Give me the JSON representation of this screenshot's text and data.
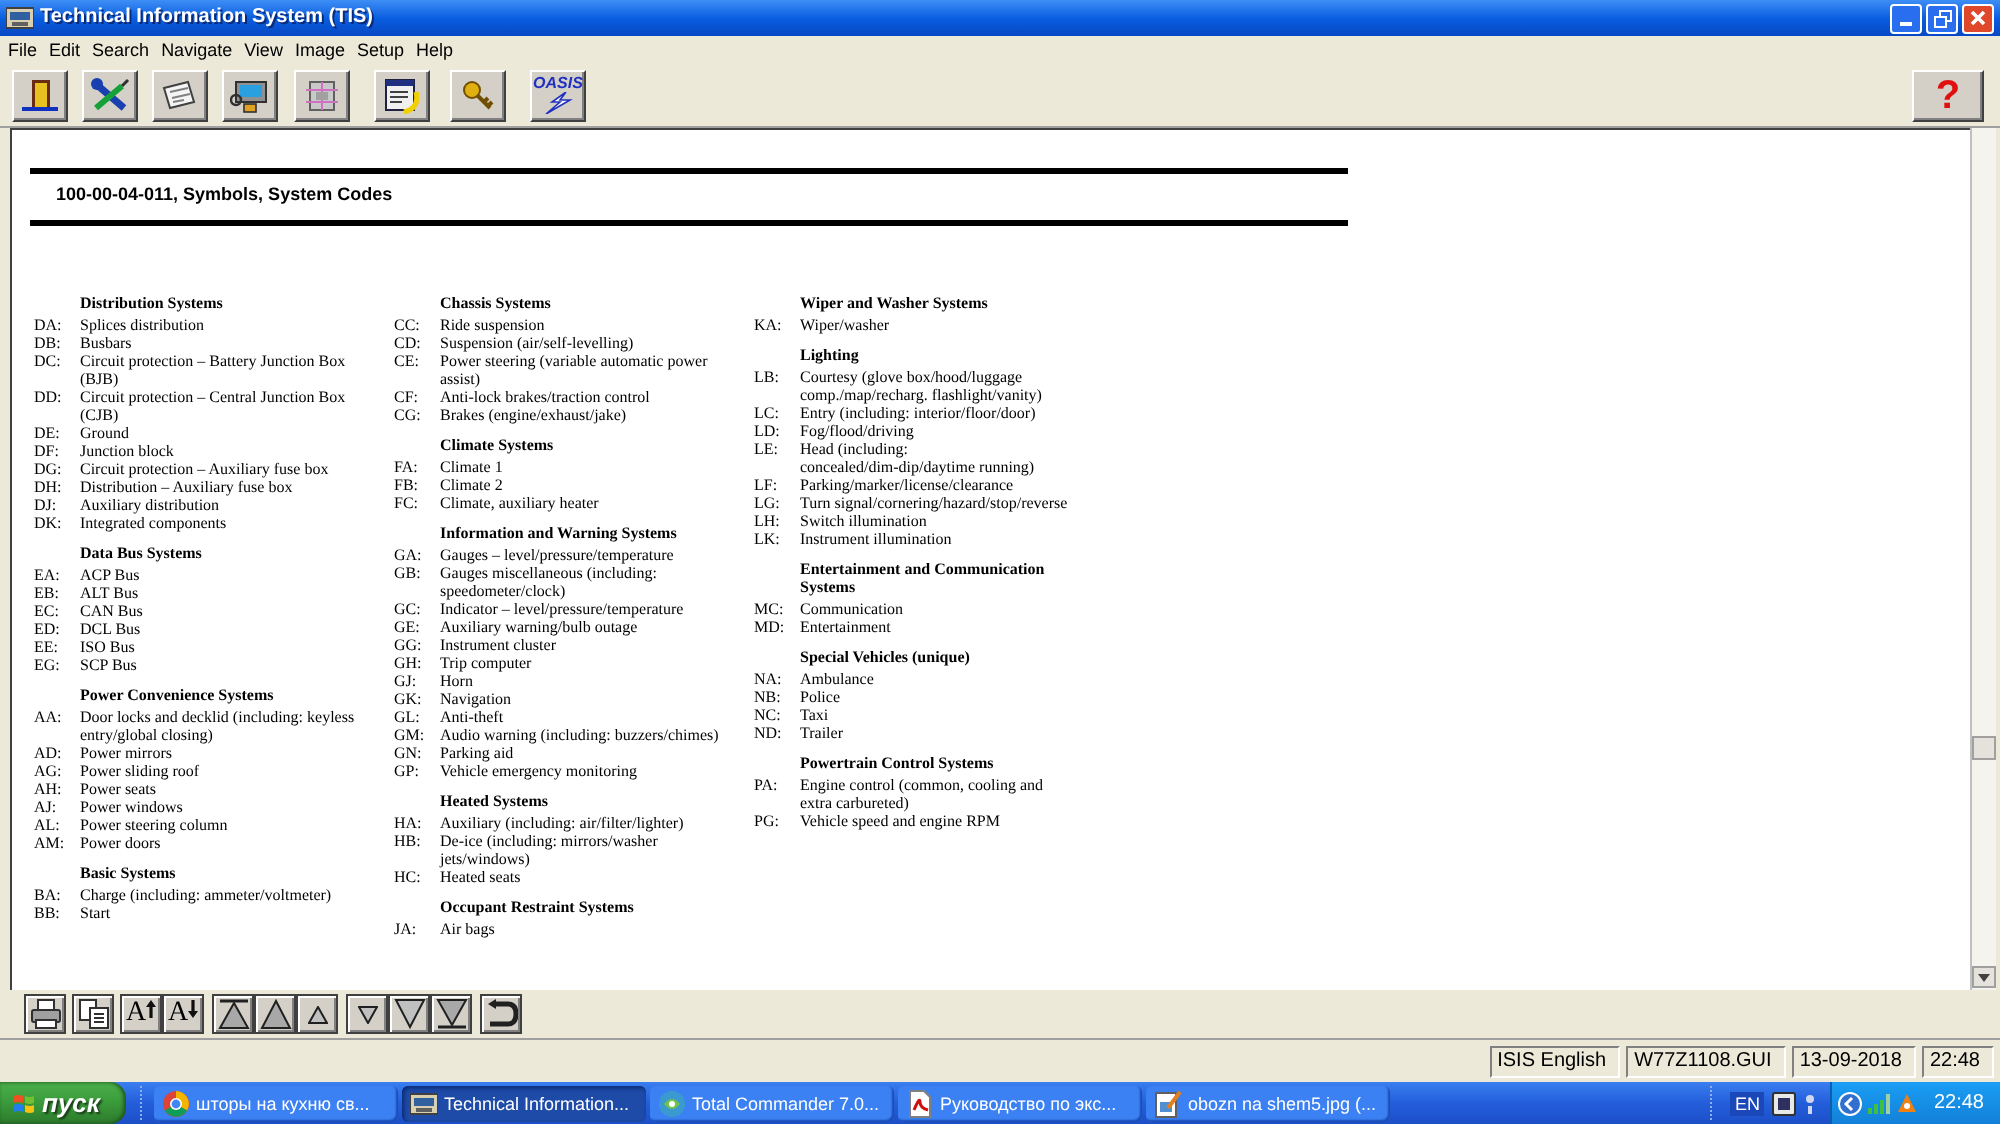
{
  "window": {
    "title": "Technical Information System (TIS)"
  },
  "menu": [
    "File",
    "Edit",
    "Search",
    "Navigate",
    "View",
    "Image",
    "Setup",
    "Help"
  ],
  "toolbar": {
    "logo_label": "OASIS",
    "help_label": "?"
  },
  "document": {
    "title": "100-00-04-011, Symbols, System Codes",
    "columns": [
      {
        "sections": [
          {
            "heading": "Distribution Systems",
            "entries": [
              {
                "code": "DA:",
                "text": "Splices distribution"
              },
              {
                "code": "DB:",
                "text": "Busbars"
              },
              {
                "code": "DC:",
                "text": "Circuit protection – Battery Junction Box\n(BJB)"
              },
              {
                "code": "DD:",
                "text": "Circuit protection – Central Junction Box\n(CJB)"
              },
              {
                "code": "DE:",
                "text": "Ground"
              },
              {
                "code": "DF:",
                "text": "Junction block"
              },
              {
                "code": "DG:",
                "text": "Circuit protection – Auxiliary fuse box"
              },
              {
                "code": "DH:",
                "text": "Distribution – Auxiliary fuse box"
              },
              {
                "code": "DJ:",
                "text": "Auxiliary distribution"
              },
              {
                "code": "DK:",
                "text": "Integrated components"
              }
            ]
          },
          {
            "heading": "Data Bus Systems",
            "entries": [
              {
                "code": "EA:",
                "text": "ACP Bus"
              },
              {
                "code": "EB:",
                "text": "ALT Bus"
              },
              {
                "code": "EC:",
                "text": "CAN Bus"
              },
              {
                "code": "ED:",
                "text": "DCL Bus"
              },
              {
                "code": "EE:",
                "text": "ISO Bus"
              },
              {
                "code": "EG:",
                "text": "SCP Bus"
              }
            ]
          },
          {
            "heading": "Power Convenience Systems",
            "entries": [
              {
                "code": "AA:",
                "text": "Door locks and decklid (including: keyless\nentry/global closing)"
              },
              {
                "code": "AD:",
                "text": "Power mirrors"
              },
              {
                "code": "AG:",
                "text": "Power sliding roof"
              },
              {
                "code": "AH:",
                "text": "Power seats"
              },
              {
                "code": "AJ:",
                "text": "Power windows"
              },
              {
                "code": "AL:",
                "text": "Power steering column"
              },
              {
                "code": "AM:",
                "text": "Power doors"
              }
            ]
          },
          {
            "heading": "Basic Systems",
            "entries": [
              {
                "code": "BA:",
                "text": "Charge (including: ammeter/voltmeter)"
              },
              {
                "code": "BB:",
                "text": "Start"
              }
            ]
          }
        ]
      },
      {
        "sections": [
          {
            "heading": "Chassis Systems",
            "entries": [
              {
                "code": "CC:",
                "text": "Ride suspension"
              },
              {
                "code": "CD:",
                "text": "Suspension (air/self-levelling)"
              },
              {
                "code": "CE:",
                "text": "Power steering (variable automatic power\nassist)"
              },
              {
                "code": "CF:",
                "text": "Anti-lock brakes/traction control"
              },
              {
                "code": "CG:",
                "text": "Brakes (engine/exhaust/jake)"
              }
            ]
          },
          {
            "heading": "Climate Systems",
            "entries": [
              {
                "code": "FA:",
                "text": "Climate 1"
              },
              {
                "code": "FB:",
                "text": "Climate 2"
              },
              {
                "code": "FC:",
                "text": "Climate, auxiliary heater"
              }
            ]
          },
          {
            "heading": "Information and Warning Systems",
            "entries": [
              {
                "code": "GA:",
                "text": "Gauges – level/pressure/temperature"
              },
              {
                "code": "GB:",
                "text": "Gauges miscellaneous (including:\nspeedometer/clock)"
              },
              {
                "code": "GC:",
                "text": "Indicator – level/pressure/temperature"
              },
              {
                "code": "GE:",
                "text": "Auxiliary warning/bulb outage"
              },
              {
                "code": "GG:",
                "text": "Instrument cluster"
              },
              {
                "code": "GH:",
                "text": "Trip computer"
              },
              {
                "code": "GJ:",
                "text": "Horn"
              },
              {
                "code": "GK:",
                "text": "Navigation"
              },
              {
                "code": "GL:",
                "text": "Anti-theft"
              },
              {
                "code": "GM:",
                "text": "Audio warning (including: buzzers/chimes)"
              },
              {
                "code": "GN:",
                "text": "Parking aid"
              },
              {
                "code": "GP:",
                "text": "Vehicle emergency monitoring"
              }
            ]
          },
          {
            "heading": "Heated Systems",
            "entries": [
              {
                "code": "HA:",
                "text": "Auxiliary (including: air/filter/lighter)"
              },
              {
                "code": "HB:",
                "text": "De-ice (including: mirrors/washer\njets/windows)"
              },
              {
                "code": "HC:",
                "text": "Heated seats"
              }
            ]
          },
          {
            "heading": "Occupant Restraint Systems",
            "entries": [
              {
                "code": "JA:",
                "text": "Air bags"
              }
            ]
          }
        ]
      },
      {
        "sections": [
          {
            "heading": "Wiper and Washer Systems",
            "entries": [
              {
                "code": "KA:",
                "text": "Wiper/washer"
              }
            ]
          },
          {
            "heading": "Lighting",
            "entries": [
              {
                "code": "LB:",
                "text": "Courtesy (glove box/hood/luggage\ncomp./map/recharg. flashlight/vanity)"
              },
              {
                "code": "LC:",
                "text": "Entry (including: interior/floor/door)"
              },
              {
                "code": "LD:",
                "text": "Fog/flood/driving"
              },
              {
                "code": "LE:",
                "text": "Head (including:\nconcealed/dim-dip/daytime running)"
              },
              {
                "code": "LF:",
                "text": "Parking/marker/license/clearance"
              },
              {
                "code": "LG:",
                "text": "Turn signal/cornering/hazard/stop/reverse"
              },
              {
                "code": "LH:",
                "text": "Switch illumination"
              },
              {
                "code": "LK:",
                "text": "Instrument illumination"
              }
            ]
          },
          {
            "heading": "Entertainment and Communication\nSystems",
            "entries": [
              {
                "code": "MC:",
                "text": "Communication"
              },
              {
                "code": "MD:",
                "text": "Entertainment"
              }
            ]
          },
          {
            "heading": "Special Vehicles (unique)",
            "entries": [
              {
                "code": "NA:",
                "text": "Ambulance"
              },
              {
                "code": "NB:",
                "text": "Police"
              },
              {
                "code": "NC:",
                "text": "Taxi"
              },
              {
                "code": "ND:",
                "text": "Trailer"
              }
            ]
          },
          {
            "heading": "Powertrain Control Systems",
            "entries": [
              {
                "code": "PA:",
                "text": "Engine control (common, cooling and\nextra carbureted)"
              },
              {
                "code": "PG:",
                "text": "Vehicle speed and engine RPM"
              }
            ]
          }
        ]
      }
    ]
  },
  "bottom_toolbar": {
    "font_larger_label": "A",
    "font_smaller_label": "A"
  },
  "status_bar": [
    "ISIS English",
    "W77Z1108.GUI",
    "13-09-2018",
    "22:48"
  ],
  "taskbar": {
    "start_label": "пуск",
    "tasks": [
      {
        "kind": "browser",
        "label": "шторы на кухню св...",
        "selected": false
      },
      {
        "kind": "app",
        "label": "Technical Information...",
        "selected": true
      },
      {
        "kind": "commander",
        "label": "Total Commander 7.0...",
        "selected": false
      },
      {
        "kind": "pdf",
        "label": "Руководство по экс...",
        "selected": false
      },
      {
        "kind": "image",
        "label": "obozn na shem5.jpg (...",
        "selected": false
      }
    ],
    "language": "EN",
    "clock": "22:48"
  }
}
